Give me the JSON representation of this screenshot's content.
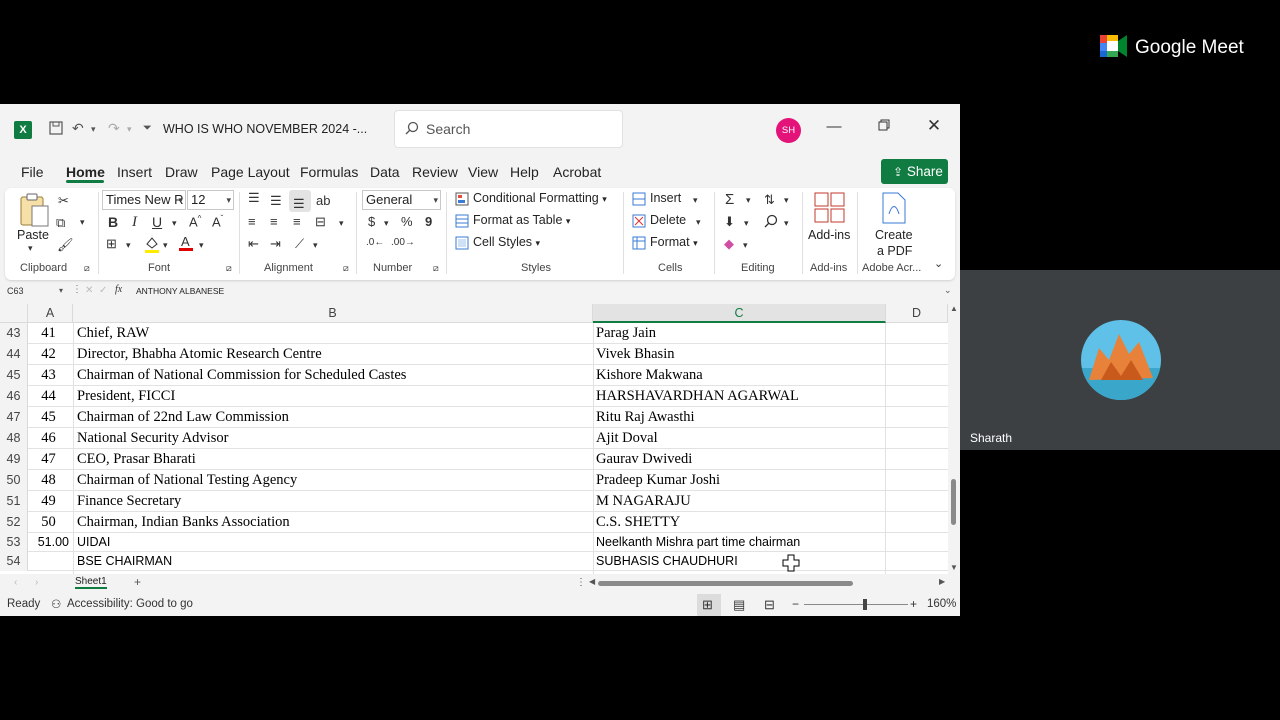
{
  "excel": {
    "title": "WHO IS WHO NOVEMBER 2024  -...",
    "search_placeholder": "Search",
    "avatar_initials": "SH",
    "menu": [
      "File",
      "Home",
      "Insert",
      "Draw",
      "Page Layout",
      "Formulas",
      "Data",
      "Review",
      "View",
      "Help",
      "Acrobat"
    ],
    "active_menu": "Home",
    "share_label": "Share",
    "ribbon": {
      "paste": "Paste",
      "font_name": "Times New R",
      "font_size": "12",
      "number_format": "General",
      "conditional_formatting": "Conditional Formatting",
      "format_as_table": "Format as Table",
      "cell_styles": "Cell Styles",
      "insert": "Insert",
      "delete": "Delete",
      "format": "Format",
      "add_ins": "Add-ins",
      "create_pdf_1": "Create",
      "create_pdf_2": "a PDF",
      "groups": {
        "clipboard": "Clipboard",
        "font": "Font",
        "alignment": "Alignment",
        "number": "Number",
        "styles": "Styles",
        "cells": "Cells",
        "editing": "Editing",
        "addins": "Add-ins",
        "adobe": "Adobe Acr..."
      }
    },
    "name_box": "C63",
    "formula_value": "ANTHONY ALBANESE",
    "columns": [
      "A",
      "B",
      "C",
      "D"
    ],
    "rows": [
      {
        "num": "43",
        "a": "41",
        "b": "Chief, RAW",
        "c": "Parag Jain"
      },
      {
        "num": "44",
        "a": "42",
        "b": "Director, Bhabha Atomic Research Centre",
        "c": "Vivek Bhasin"
      },
      {
        "num": "45",
        "a": "43",
        "b": "Chairman of National Commission for Scheduled Castes",
        "c": "Kishore Makwana"
      },
      {
        "num": "46",
        "a": "44",
        "b": "President, FICCI",
        "c": "HARSHAVARDHAN AGARWAL"
      },
      {
        "num": "47",
        "a": "45",
        "b": "Chairman of 22nd Law Commission",
        "c": "Ritu Raj Awasthi"
      },
      {
        "num": "48",
        "a": "46",
        "b": "National Security Advisor",
        "c": "Ajit Doval"
      },
      {
        "num": "49",
        "a": "47",
        "b": "CEO, Prasar Bharati",
        "c": "Gaurav Dwivedi"
      },
      {
        "num": "50",
        "a": "48",
        "b": "Chairman of National Testing Agency",
        "c": "Pradeep Kumar Joshi"
      },
      {
        "num": "51",
        "a": "49",
        "b": "Finance Secretary",
        "c": "M NAGARAJU"
      },
      {
        "num": "52",
        "a": "50",
        "b": "Chairman, Indian Banks Association",
        "c": "C.S. SHETTY"
      },
      {
        "num": "53",
        "a": "51.00",
        "b": "UIDAI",
        "c": "Neelkanth Mishra part time chairman"
      },
      {
        "num": "54",
        "a": "",
        "b": "BSE CHAIRMAN",
        "c": "SUBHASIS CHAUDHURI"
      }
    ],
    "sheet_tab": "Sheet1",
    "status_ready": "Ready",
    "accessibility": "Accessibility: Good to go",
    "zoom": "160%"
  },
  "meet": {
    "brand": "Google Meet",
    "participant_name": "Sharath"
  }
}
